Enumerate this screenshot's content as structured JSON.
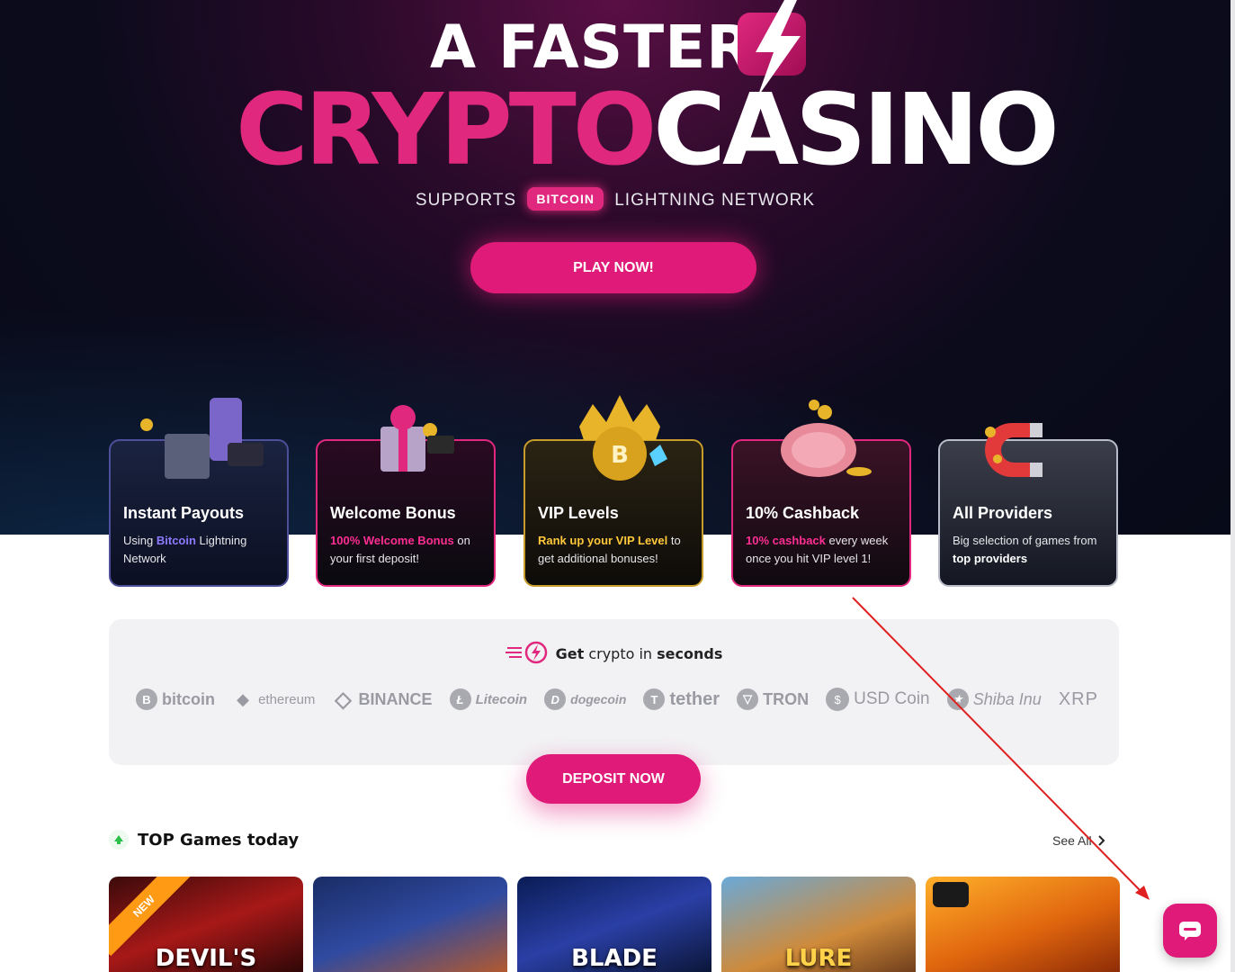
{
  "hero": {
    "line1": "A FASTER",
    "crypto": "CRYPTO",
    "casino": "CASINO",
    "supports": "SUPPORTS",
    "badge": "BITCOIN",
    "network": "LIGHTNING NETWORK",
    "play_button": "PLAY NOW!"
  },
  "features": [
    {
      "title": "Instant Payouts",
      "pre": "Using ",
      "highlight": "Bitcoin",
      "post": " Lightning Network"
    },
    {
      "title": "Welcome Bonus",
      "pre": "",
      "highlight": "100% Welcome Bonus",
      "post": " on your first deposit!"
    },
    {
      "title": "VIP Levels",
      "pre": "",
      "highlight": "Rank up your VIP Level",
      "post": " to get additional bonuses!"
    },
    {
      "title": "10% Cashback",
      "pre": "",
      "highlight": "10% cashback",
      "post": " every week once you hit VIP level 1!"
    },
    {
      "title": "All Providers",
      "pre": "Big selection of games from ",
      "highlight": "top providers",
      "post": ""
    }
  ],
  "crypto": {
    "get": "Get",
    "crypto_in": " crypto in ",
    "seconds": "seconds",
    "coins": [
      {
        "icon": "B",
        "name": "bitcoin"
      },
      {
        "icon": "◆",
        "name": "ethereum"
      },
      {
        "icon": "◇",
        "name": "BINANCE"
      },
      {
        "icon": "Ł",
        "name": "Litecoin"
      },
      {
        "icon": "D",
        "name": "dogecoin"
      },
      {
        "icon": "T",
        "name": "tether"
      },
      {
        "icon": "▽",
        "name": "TRON"
      },
      {
        "icon": "$",
        "name": "USD Coin"
      },
      {
        "icon": "★",
        "name": "Shiba Inu"
      },
      {
        "icon": "",
        "name": "XRP"
      }
    ],
    "deposit_button": "DEPOSIT NOW"
  },
  "games": {
    "section_title": "TOP Games today",
    "see_all": "See All",
    "ribbon": "NEW",
    "items": [
      {
        "name": "DEVIL'S"
      },
      {
        "name": ""
      },
      {
        "name": "BLADE"
      },
      {
        "name": "LURE"
      },
      {
        "name": ""
      }
    ]
  },
  "colors": {
    "accent": "#e01a78",
    "hero_bg": "#0c0b1c",
    "panel_bg": "#f2f2f4"
  },
  "icons": {
    "chat": "chat-bubble-icon",
    "bolt": "lightning-bolt-icon",
    "arrow": "chevron-right-icon",
    "up": "arrow-up-icon"
  }
}
